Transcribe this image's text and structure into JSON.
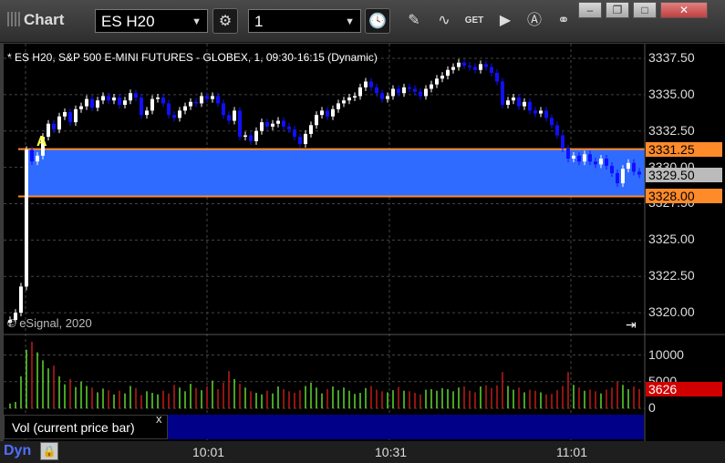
{
  "window": {
    "title": "Chart",
    "symbol": "ES H20",
    "interval": "1",
    "buttons": [
      "minimize",
      "restore",
      "maximize",
      "close"
    ]
  },
  "chart_header": "* ES H20, S&P 500 E-MINI FUTURES - GLOBEX, 1, 09:30-16:15 (Dynamic)",
  "copyright": "© eSignal, 2020",
  "volume_panel_label": "Vol (current price bar)",
  "close_panel": "x",
  "footer": {
    "mode": "Dyn"
  },
  "annotation_letter": "A",
  "colors": {
    "up": "#ffffff",
    "down": "#1010ff",
    "zone": "#2f6bff",
    "zone_line": "#ff8a2a",
    "vol_up": "#60d830",
    "vol_down": "#c01a1a"
  },
  "chart_data": {
    "type": "candlestick",
    "price_axis_ticks": [
      "3337.50",
      "3335.00",
      "3332.50",
      "3330.00",
      "3327.50",
      "3325.00",
      "3322.50",
      "3320.00"
    ],
    "price_range": [
      3318.5,
      3338.5
    ],
    "volume_axis_ticks": [
      "10000",
      "5000",
      "0"
    ],
    "volume_range": [
      0,
      13000
    ],
    "time_labels": [
      "10:01",
      "10:31",
      "11:01"
    ],
    "zone": {
      "top": 3331.25,
      "bottom": 3328.0,
      "top_label": "3331.25",
      "bottom_label": "3328.00"
    },
    "last_price": {
      "value": 3329.5,
      "label": "3329.50"
    },
    "last_volume": {
      "value": 3626,
      "label": "3626"
    },
    "closes": [
      3319.5,
      3320.0,
      3321.8,
      3331.2,
      3330.4,
      3330.8,
      3332.1,
      3333.0,
      3332.6,
      3333.5,
      3333.8,
      3333.1,
      3334.0,
      3334.2,
      3334.7,
      3334.1,
      3334.6,
      3334.9,
      3334.6,
      3334.8,
      3334.3,
      3334.6,
      3335.1,
      3334.8,
      3333.6,
      3333.9,
      3334.7,
      3334.8,
      3334.4,
      3333.6,
      3333.4,
      3333.9,
      3334.2,
      3334.5,
      3334.4,
      3334.9,
      3334.7,
      3334.9,
      3334.4,
      3333.6,
      3333.2,
      3333.9,
      3332.1,
      3332.2,
      3331.8,
      3332.5,
      3333.1,
      3332.8,
      3333.0,
      3333.2,
      3332.8,
      3332.6,
      3332.1,
      3331.6,
      3332.3,
      3332.9,
      3333.6,
      3333.9,
      3333.5,
      3334.0,
      3334.4,
      3334.6,
      3334.8,
      3334.9,
      3335.5,
      3335.9,
      3335.5,
      3335.1,
      3334.7,
      3334.9,
      3335.4,
      3335.1,
      3335.5,
      3335.4,
      3335.2,
      3334.9,
      3335.4,
      3335.7,
      3336.1,
      3336.3,
      3336.7,
      3336.9,
      3337.2,
      3337.0,
      3336.9,
      3336.7,
      3337.1,
      3336.9,
      3336.5,
      3335.9,
      3334.3,
      3334.6,
      3334.8,
      3334.2,
      3334.5,
      3333.9,
      3333.7,
      3333.9,
      3333.4,
      3332.9,
      3332.2,
      3331.3,
      3330.6,
      3330.8,
      3330.4,
      3330.9,
      3330.4,
      3330.2,
      3330.6,
      3330.1,
      3329.6,
      3328.9,
      3329.9,
      3330.3,
      3329.7,
      3329.5
    ],
    "volumes": [
      900,
      1200,
      6000,
      11000,
      12500,
      10500,
      9000,
      7500,
      8000,
      6000,
      4500,
      5500,
      4000,
      5000,
      4200,
      3900,
      3000,
      3700,
      3400,
      2600,
      3300,
      2800,
      4200,
      3800,
      2500,
      3200,
      2900,
      2600,
      3300,
      2800,
      4400,
      3900,
      3200,
      4600,
      3800,
      3400,
      4100,
      5200,
      3600,
      4800,
      7000,
      5500,
      4600,
      3900,
      3200,
      2900,
      2600,
      3300,
      2800,
      4100,
      3600,
      3200,
      2900,
      3400,
      4200,
      4800,
      3900,
      2800,
      3600,
      4100,
      3400,
      3900,
      3300,
      2700,
      2900,
      3800,
      4200,
      3500,
      3200,
      3000,
      3400,
      4000,
      3300,
      3200,
      2900,
      2600,
      3500,
      3600,
      3300,
      3800,
      3600,
      3200,
      3900,
      4100,
      3300,
      3000,
      4100,
      4300,
      3800,
      4300,
      6800,
      4200,
      3500,
      3900,
      3000,
      3500,
      3300,
      3000,
      2600,
      2700,
      3400,
      4200,
      6800,
      4400,
      3900,
      3300,
      3500,
      3200,
      2800,
      3500,
      3900,
      5000,
      4400,
      3600,
      4100,
      3626
    ]
  }
}
